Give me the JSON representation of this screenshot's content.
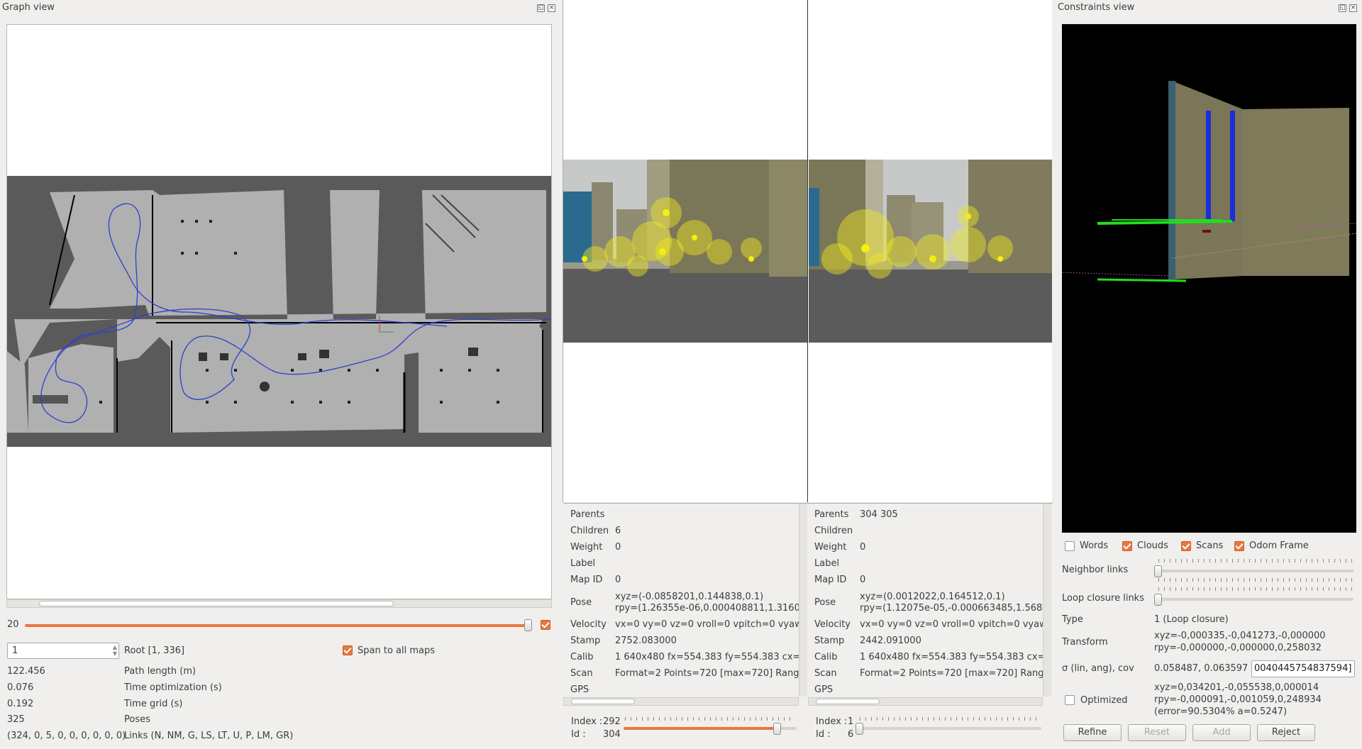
{
  "graph_view": {
    "title": "Graph view",
    "max_graph_depth": "20",
    "root_spin_value": "1",
    "root_text": "Root [1, 336]",
    "span_to_all_maps_label": "Span to all maps",
    "stats": [
      {
        "value": "122.456",
        "label": "Path length (m)"
      },
      {
        "value": "0.076",
        "label": "Time optimization (s)"
      },
      {
        "value": "0.192",
        "label": "Time grid (s)"
      },
      {
        "value": "325",
        "label": "Poses"
      },
      {
        "value": "(324, 0, 5, 0, 0, 0, 0, 0, 0)",
        "label": "Links (N, NM, G, LS, LT, U, P, LM, GR)"
      }
    ],
    "depth_slider_fraction": 0.99,
    "depth_checked": true
  },
  "node_a": {
    "info": {
      "parents_label": "Parents",
      "parents_value": "",
      "children_label": "Children",
      "children_value": "6",
      "weight_label": "Weight",
      "weight_value": "0",
      "label_label": "Label",
      "label_value": "",
      "mapid_label": "Map ID",
      "mapid_value": "0",
      "pose_label": "Pose",
      "pose_xyz": "xyz=(-0.0858201,0.144838,0.1)",
      "pose_rpy": "rpy=(1.26355e-06,0.000408811,1.3160",
      "velocity_label": "Velocity",
      "velocity_value": "vx=0 vy=0 vz=0 vroll=0 vpitch=0 vyaw=",
      "stamp_label": "Stamp",
      "stamp_value": "2752.083000",
      "calib_label": "Calib",
      "calib_value": "1 640x480 fx=554.383 fy=554.383 cx=",
      "scan_label": "Scan",
      "scan_value": "Format=2 Points=720 [max=720] Rang",
      "gps_label": "GPS"
    },
    "index_label": "Index :",
    "index_value": "292",
    "id_label": "Id :",
    "id_value": "304",
    "slider_fraction": 0.97
  },
  "node_b": {
    "info": {
      "parents_label": "Parents",
      "parents_value": "304 305",
      "children_label": "Children",
      "children_value": "",
      "weight_label": "Weight",
      "weight_value": "0",
      "label_label": "Label",
      "label_value": "",
      "mapid_label": "Map ID",
      "mapid_value": "0",
      "pose_label": "Pose",
      "pose_xyz": "xyz=(0.0012022,0.164512,0.1)",
      "pose_rpy": "rpy=(1.12075e-05,-0.000663485,1.568",
      "velocity_label": "Velocity",
      "velocity_value": "vx=0 vy=0 vz=0 vroll=0 vpitch=0 vyaw=",
      "stamp_label": "Stamp",
      "stamp_value": "2442.091000",
      "calib_label": "Calib",
      "calib_value": "1 640x480 fx=554.383 fy=554.383 cx=",
      "scan_label": "Scan",
      "scan_value": "Format=2 Points=720 [max=720] Rang",
      "gps_label": "GPS"
    },
    "index_label": "Index :",
    "index_value": "1",
    "id_label": "Id :",
    "id_value": "6",
    "slider_fraction": 0.0
  },
  "constraints_view": {
    "title": "Constraints view",
    "checks": [
      {
        "label": "Words",
        "checked": false
      },
      {
        "label": "Clouds",
        "checked": true
      },
      {
        "label": "Scans",
        "checked": true
      },
      {
        "label": "Odom Frame",
        "checked": true
      }
    ],
    "neighbor_links_label": "Neighbor links",
    "loop_closure_links_label": "Loop closure links",
    "type_label": "Type",
    "type_value": "1  (Loop closure)",
    "transform_label": "Transform",
    "transform_xyz": "xyz=-0,000335,-0,041273,-0,000000",
    "transform_rpy": "rpy=-0,000000,-0,000000,0,258032",
    "sigma_label": "σ (lin, ang), cov",
    "sigma_value": "0.058487, 0.063597",
    "cov_field_value": "0040445754837594]",
    "optimized_label": "Optimized",
    "optimized_checked": false,
    "optimized_xyz": "xyz=0,034201,-0,055538,0,000014",
    "optimized_rpy": "rpy=-0,000091,-0,001059,0,248934",
    "optimized_error": "(error=90.5304% a=0.5247)",
    "buttons": {
      "refine": "Refine",
      "reset": "Reset",
      "add": "Add",
      "reject": "Reject"
    }
  },
  "icons": {
    "float": "float-icon",
    "close": "close-icon"
  },
  "colors": {
    "accent": "#e9773e",
    "path": "#2f3fd0",
    "feature": "#f0e81e"
  }
}
